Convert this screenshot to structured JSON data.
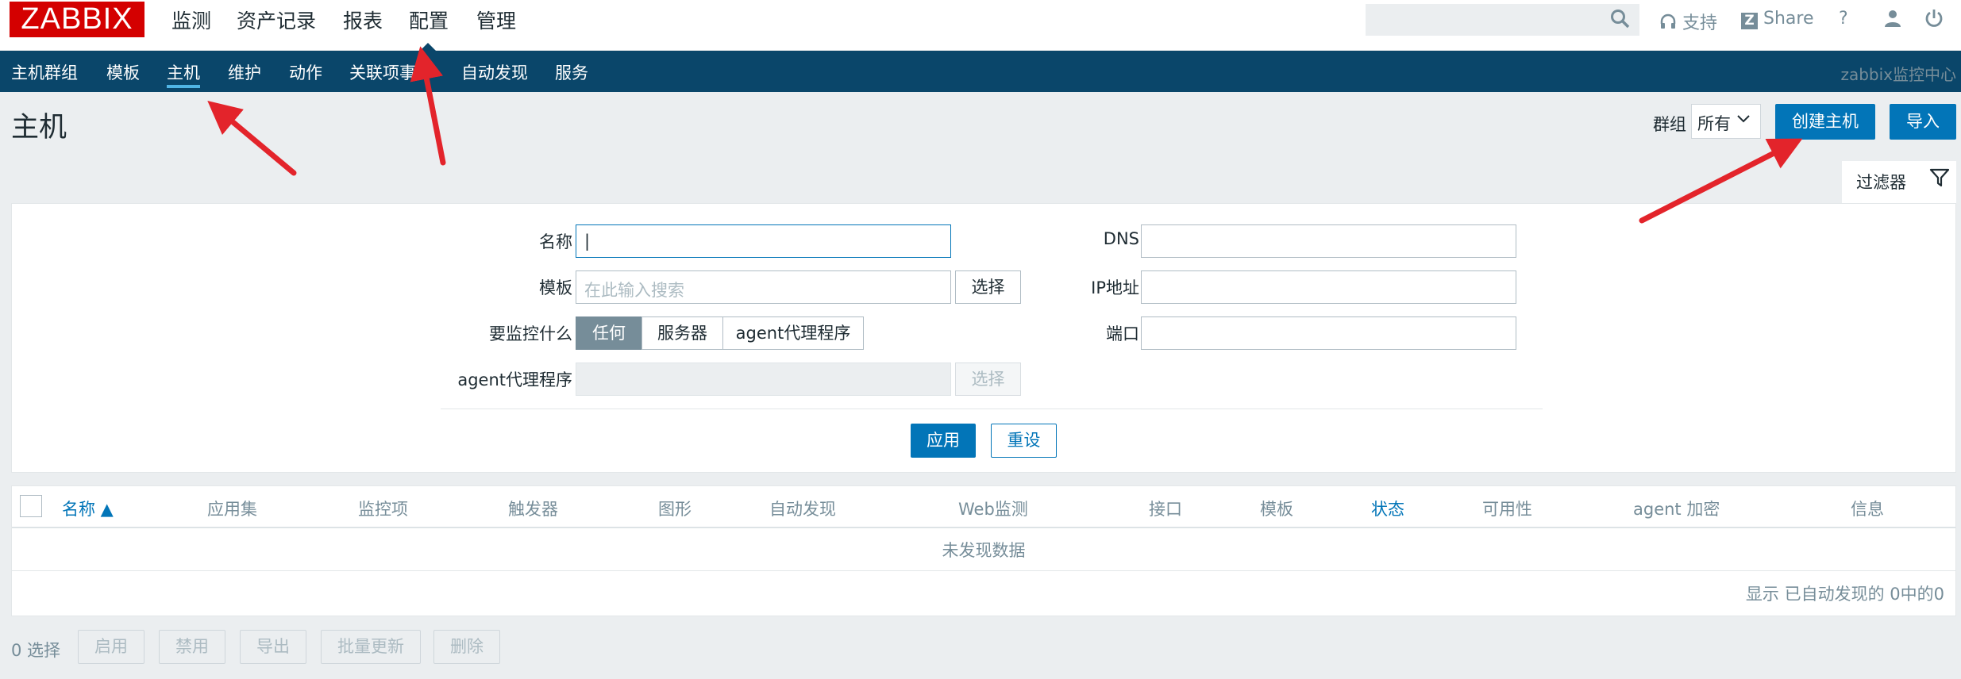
{
  "topbar": {
    "logo": "ZABBIX",
    "menu": [
      "监测",
      "资产记录",
      "报表",
      "配置",
      "管理"
    ],
    "search_value": "",
    "support": "支持",
    "share": "Share",
    "help": "?"
  },
  "subnav": {
    "items": [
      "主机群组",
      "模板",
      "主机",
      "维护",
      "动作",
      "关联项事件",
      "自动发现",
      "服务"
    ],
    "active": "主机",
    "server_name": "zabbix监控中心"
  },
  "header": {
    "title": "主机",
    "group_label": "群组",
    "group_value": "所有",
    "create_button": "创建主机",
    "import_button": "导入"
  },
  "filter": {
    "tab_label": "过滤器",
    "name_label": "名称",
    "name_value": "|",
    "template_label": "模板",
    "template_placeholder": "在此输入搜索",
    "select_button": "选择",
    "monitor_label": "要监控什么",
    "monitor_options": [
      "任何",
      "服务器",
      "agent代理程序"
    ],
    "proxy_label": "agent代理程序",
    "proxy_select_button": "选择",
    "dns_label": "DNS",
    "ip_label": "IP地址",
    "port_label": "端口",
    "apply_button": "应用",
    "reset_button": "重设"
  },
  "table": {
    "columns": [
      "名称 ▲",
      "应用集",
      "监控项",
      "触发器",
      "图形",
      "自动发现",
      "Web监测",
      "接口",
      "模板",
      "状态",
      "可用性",
      "agent 加密",
      "信息"
    ],
    "no_data": "未发现数据",
    "paging": "显示 已自动发现的 0中的0"
  },
  "footer": {
    "selected": "0 选择",
    "buttons": [
      "启用",
      "禁用",
      "导出",
      "批量更新",
      "删除"
    ]
  },
  "colors": {
    "brand_red": "#d40000",
    "nav_blue": "#0a466a",
    "primary": "#0275b8",
    "arrow": "#e3242b"
  }
}
